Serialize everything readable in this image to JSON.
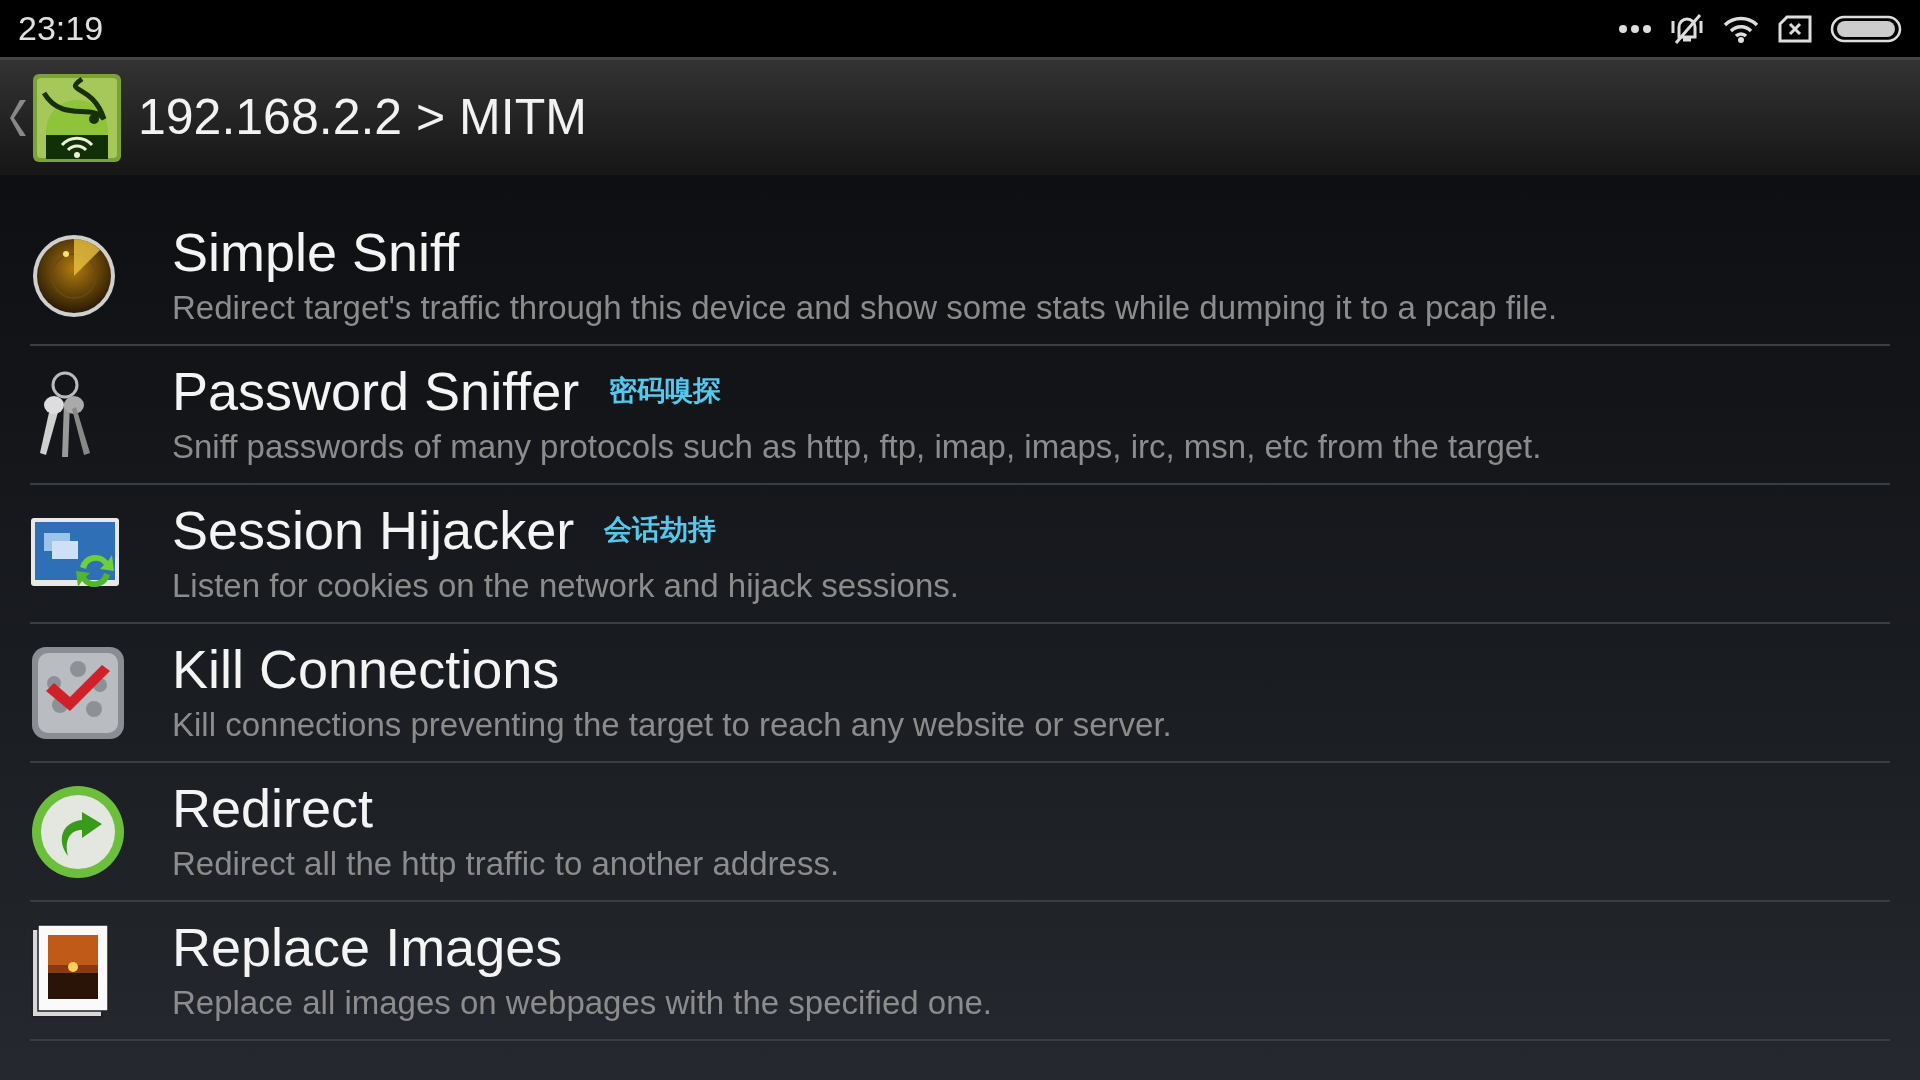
{
  "status_bar": {
    "time": "23:19"
  },
  "action_bar": {
    "title": "192.168.2.2 > MITM"
  },
  "items": [
    {
      "title": "Simple Sniff",
      "description": "Redirect target's traffic through this device and show some stats while dumping it to a pcap file."
    },
    {
      "title": "Password Sniffer",
      "tag": "密码嗅探",
      "description": "Sniff passwords of many protocols such as http, ftp, imap, imaps, irc, msn, etc from the target."
    },
    {
      "title": "Session Hijacker",
      "tag": "会话劫持",
      "description": "Listen for cookies on the network and hijack sessions."
    },
    {
      "title": "Kill Connections",
      "description": "Kill connections preventing the target to reach any website or server."
    },
    {
      "title": "Redirect",
      "description": "Redirect all the http traffic to another address."
    },
    {
      "title": "Replace Images",
      "description": "Replace all images on webpages with the specified one."
    }
  ]
}
